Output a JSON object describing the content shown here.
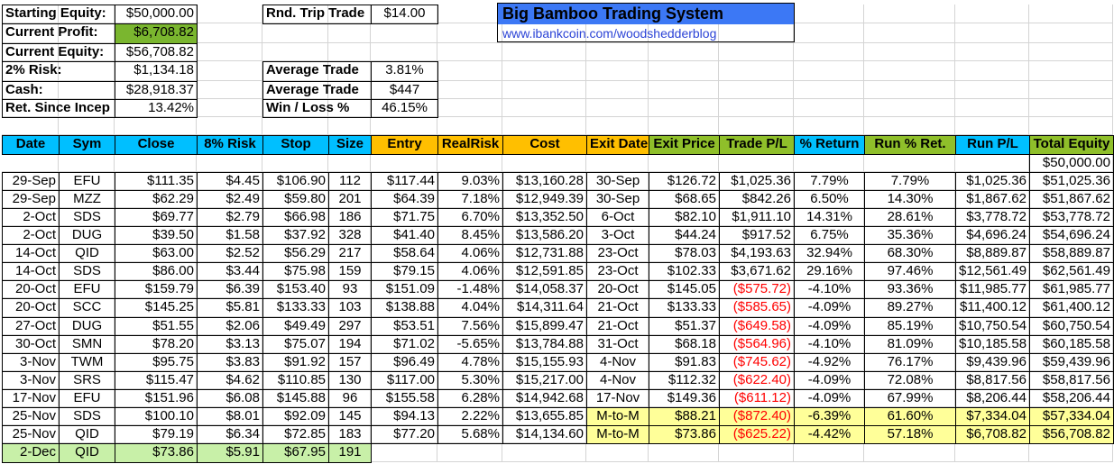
{
  "title": "Big Bamboo Trading System",
  "link": "www.ibankcoin.com/woodshedderblog",
  "colors": {
    "title_bar": "#3c78f5",
    "header_cyan": "#00bfff",
    "header_orange": "#ffbf00",
    "header_green": "#8fbf2a",
    "profit_green": "#7ab62f",
    "mtm_yellow": "#ffff99",
    "pending_green": "#c8f0a8",
    "loss_red": "#ff0000"
  },
  "summary_left": [
    {
      "label": "Starting Equity:",
      "value": "$50,000.00"
    },
    {
      "label": "Current Profit:",
      "value": "$6,708.82"
    },
    {
      "label": "Current Equity:",
      "value": "$56,708.82"
    },
    {
      "label": "2% Risk:",
      "value": "$1,134.18"
    },
    {
      "label": "Cash:",
      "value": "$28,918.37"
    },
    {
      "label": "Ret. Since Incep",
      "value": "13.42%"
    }
  ],
  "summary_right": [
    {
      "label": "Rnd. Trip Trade",
      "value": "$14.00"
    },
    {
      "label": "Average Trade",
      "value": "3.81%"
    },
    {
      "label": "Average Trade",
      "value": "$447"
    },
    {
      "label": "Win / Loss %",
      "value": "46.15%"
    }
  ],
  "headers": [
    "Date",
    "Sym",
    "Close",
    "8% Risk",
    "Stop",
    "Size",
    "Entry",
    "RealRisk",
    "Cost",
    "Exit Date",
    "Exit Price",
    "Trade P/L",
    "% Return",
    "Run % Ret.",
    "Run P/L",
    "Total Equity"
  ],
  "start_equity": "$50,000.00",
  "rows": [
    [
      "29-Sep",
      "EFU",
      "$111.35",
      "$4.45",
      "$106.90",
      "112",
      "$117.44",
      "9.03%",
      "$13,160.28",
      "30-Sep",
      "$126.72",
      "$1,025.36",
      "7.79%",
      "7.79%",
      "$1,025.36",
      "$51,025.36"
    ],
    [
      "29-Sep",
      "MZZ",
      "$62.29",
      "$2.49",
      "$59.80",
      "201",
      "$64.39",
      "7.18%",
      "$12,949.39",
      "30-Sep",
      "$68.65",
      "$842.26",
      "6.50%",
      "14.30%",
      "$1,867.62",
      "$51,867.62"
    ],
    [
      "2-Oct",
      "SDS",
      "$69.77",
      "$2.79",
      "$66.98",
      "186",
      "$71.75",
      "6.70%",
      "$13,352.50",
      "6-Oct",
      "$82.10",
      "$1,911.10",
      "14.31%",
      "28.61%",
      "$3,778.72",
      "$53,778.72"
    ],
    [
      "2-Oct",
      "DUG",
      "$39.50",
      "$1.58",
      "$37.92",
      "328",
      "$41.40",
      "8.45%",
      "$13,586.20",
      "3-Oct",
      "$44.24",
      "$917.52",
      "6.75%",
      "35.36%",
      "$4,696.24",
      "$54,696.24"
    ],
    [
      "14-Oct",
      "QID",
      "$63.00",
      "$2.52",
      "$56.29",
      "217",
      "$58.64",
      "4.06%",
      "$12,731.88",
      "23-Oct",
      "$78.03",
      "$4,193.63",
      "32.94%",
      "68.30%",
      "$8,889.87",
      "$58,889.87"
    ],
    [
      "14-Oct",
      "SDS",
      "$86.00",
      "$3.44",
      "$75.98",
      "159",
      "$79.15",
      "4.06%",
      "$12,591.85",
      "23-Oct",
      "$102.33",
      "$3,671.62",
      "29.16%",
      "97.46%",
      "$12,561.49",
      "$62,561.49"
    ],
    [
      "20-Oct",
      "EFU",
      "$159.79",
      "$6.39",
      "$153.40",
      "93",
      "$151.09",
      "-1.48%",
      "$14,058.37",
      "20-Oct",
      "$145.05",
      "($575.72)",
      "-4.10%",
      "93.36%",
      "$11,985.77",
      "$61,985.77"
    ],
    [
      "20-Oct",
      "SCC",
      "$145.25",
      "$5.81",
      "$133.33",
      "103",
      "$138.88",
      "4.04%",
      "$14,311.64",
      "21-Oct",
      "$133.33",
      "($585.65)",
      "-4.09%",
      "89.27%",
      "$11,400.12",
      "$61,400.12"
    ],
    [
      "27-Oct",
      "DUG",
      "$51.55",
      "$2.06",
      "$49.49",
      "297",
      "$53.51",
      "7.56%",
      "$15,899.47",
      "21-Oct",
      "$51.37",
      "($649.58)",
      "-4.09%",
      "85.19%",
      "$10,750.54",
      "$60,750.54"
    ],
    [
      "30-Oct",
      "SMN",
      "$78.20",
      "$3.13",
      "$75.07",
      "194",
      "$71.02",
      "-5.65%",
      "$13,784.88",
      "31-Oct",
      "$68.18",
      "($564.96)",
      "-4.10%",
      "81.09%",
      "$10,185.58",
      "$60,185.58"
    ],
    [
      "3-Nov",
      "TWM",
      "$95.75",
      "$3.83",
      "$91.92",
      "157",
      "$96.49",
      "4.78%",
      "$15,155.93",
      "4-Nov",
      "$91.83",
      "($745.62)",
      "-4.92%",
      "76.17%",
      "$9,439.96",
      "$59,439.96"
    ],
    [
      "3-Nov",
      "SRS",
      "$115.47",
      "$4.62",
      "$110.85",
      "130",
      "$117.00",
      "5.30%",
      "$15,217.00",
      "4-Nov",
      "$112.32",
      "($622.40)",
      "-4.09%",
      "72.08%",
      "$8,817.56",
      "$58,817.56"
    ],
    [
      "17-Nov",
      "EFU",
      "$151.96",
      "$6.08",
      "$145.88",
      "96",
      "$155.58",
      "6.28%",
      "$14,942.68",
      "17-Nov",
      "$149.36",
      "($611.12)",
      "-4.09%",
      "67.99%",
      "$8,206.44",
      "$58,206.44"
    ],
    [
      "25-Nov",
      "SDS",
      "$100.10",
      "$8.01",
      "$92.09",
      "145",
      "$94.13",
      "2.22%",
      "$13,655.85",
      "M-to-M",
      "$88.21",
      "($872.40)",
      "-6.39%",
      "61.60%",
      "$7,334.04",
      "$57,334.04"
    ],
    [
      "25-Nov",
      "QID",
      "$79.19",
      "$6.34",
      "$72.85",
      "183",
      "$77.20",
      "5.68%",
      "$14,134.60",
      "M-to-M",
      "$73.86",
      "($625.22)",
      "-4.42%",
      "57.18%",
      "$6,708.82",
      "$56,708.82"
    ]
  ],
  "pending_row": [
    "2-Dec",
    "QID",
    "$73.86",
    "$5.91",
    "$67.95",
    "191"
  ]
}
